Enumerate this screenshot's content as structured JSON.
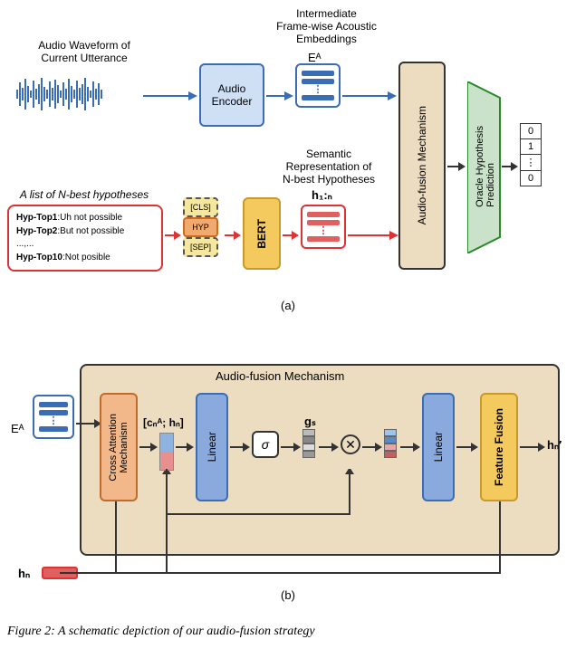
{
  "a": {
    "audioWaveLabel": "Audio Waveform of\nCurrent Utterance",
    "intermedLabel": "Intermediate\nFrame-wise Acoustic\nEmbeddings",
    "EA": "Eᴬ",
    "audioEncoder": "Audio\nEncoder",
    "nbestLabel": "A list of N-best hypotheses",
    "hyps": [
      {
        "k": "Hyp-Top1",
        "v": ":Uh not possible"
      },
      {
        "k": "Hyp-Top2",
        "v": ":But not possible"
      },
      {
        "k": "...,...",
        "v": ""
      },
      {
        "k": "Hyp-Top10",
        "v": ":Not posible"
      }
    ],
    "tokens": [
      "[CLS]",
      "HYP",
      "[SEP]"
    ],
    "bert": "BERT",
    "semLabel": "Semantic\nRepresentation of\nN-best Hypotheses",
    "h1N": "h₁:ₙ",
    "audioFusion": "Audio-fusion Mechanism",
    "oracle": "Oracle Hypothesis\nPrediction",
    "out": [
      "0",
      "1",
      "⋮",
      "0"
    ],
    "sub": "(a)"
  },
  "b": {
    "title": "Audio-fusion Mechanism",
    "EA": "Eᴬ",
    "hn": "hₙ",
    "crossAttn": "Cross Attention\nMechanism",
    "concat": "[cₙᴬ; hₙ]",
    "linear": "Linear",
    "sigma": "σ",
    "gs": "gₛ",
    "featFusion": "Feature Fusion",
    "hnPrime": "hₙ′",
    "sub": "(b)"
  },
  "caption": "Figure 2: A schematic depiction of our audio-fusion strategy"
}
